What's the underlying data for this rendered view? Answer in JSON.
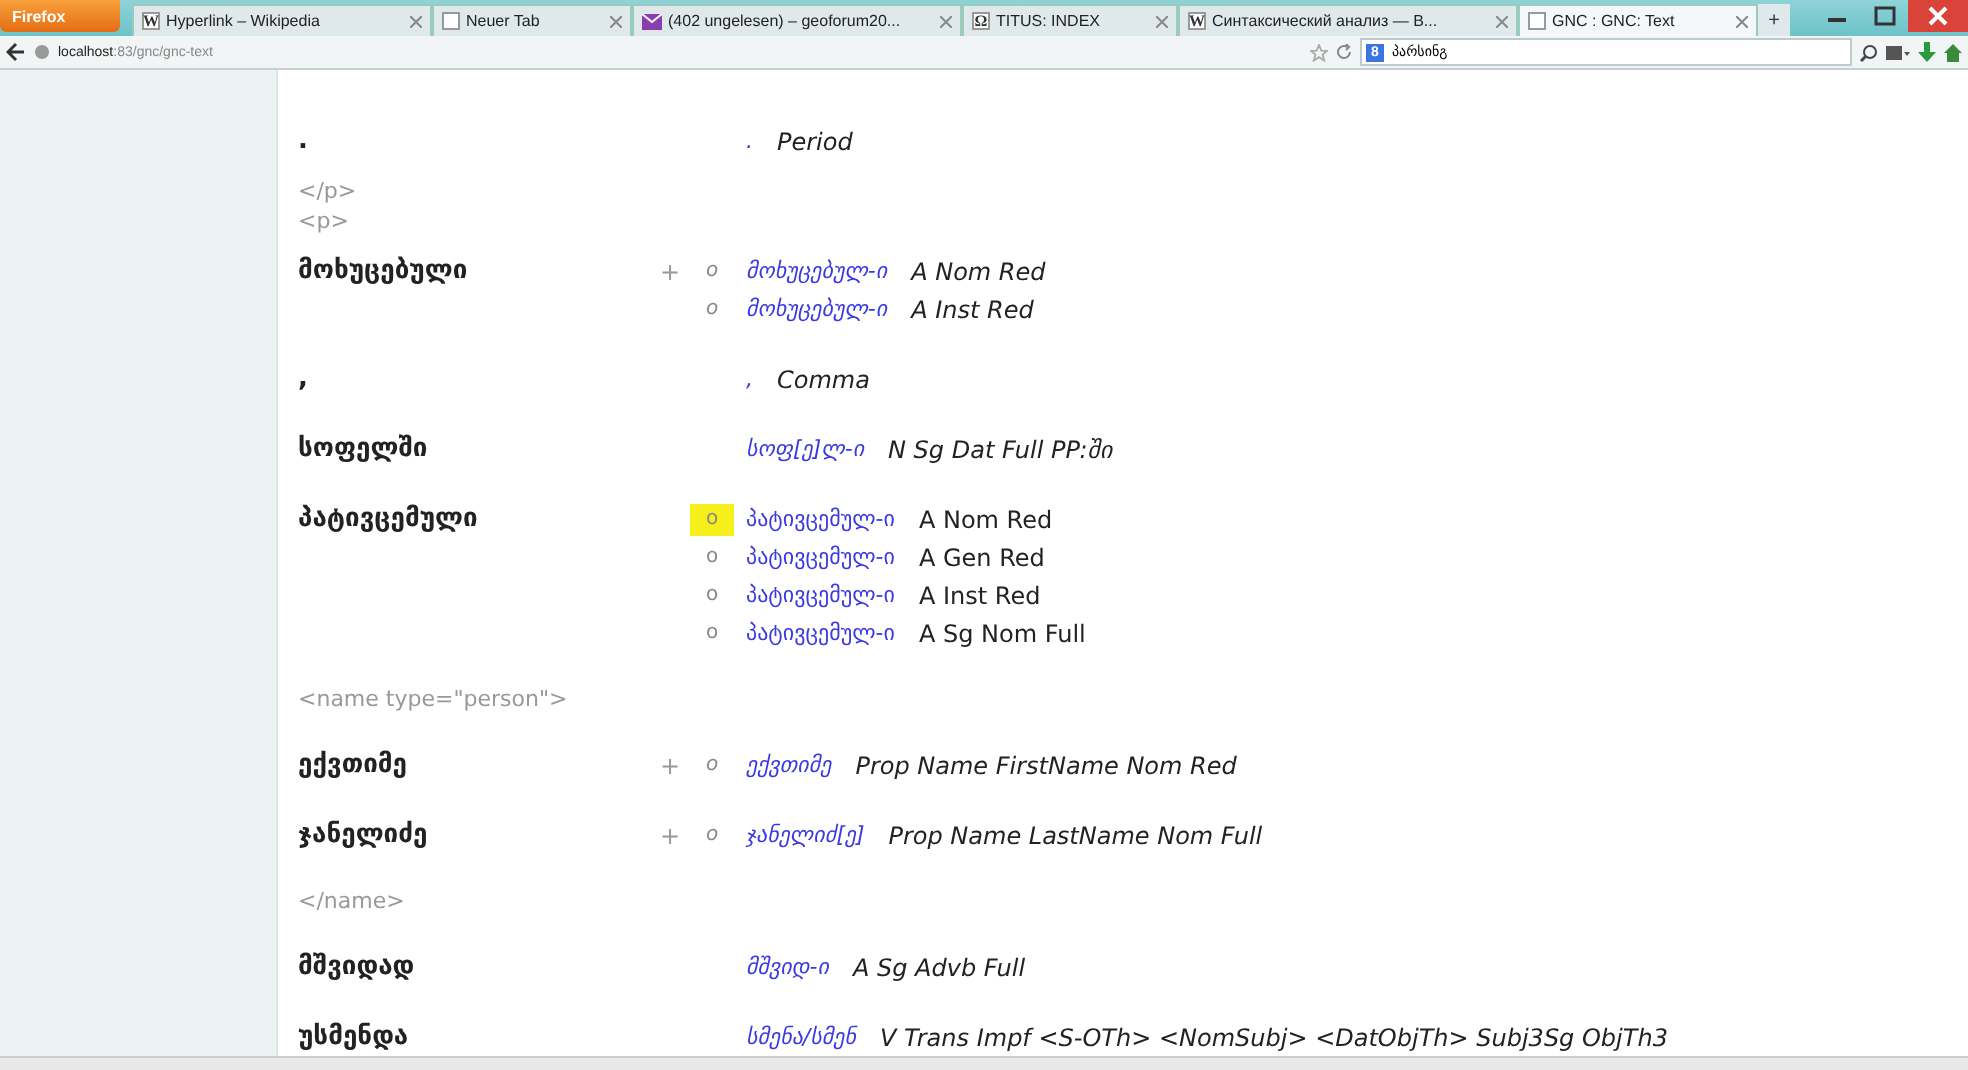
{
  "browser": {
    "menu_button": "Firefox",
    "tabs": [
      {
        "title": "Hyperlink – Wikipedia",
        "kind": "glyph",
        "icon": "W",
        "selected": false
      },
      {
        "title": "Neuer Tab",
        "kind": "page",
        "selected": false
      },
      {
        "title": "(402 ungelesen) – geoforum20...",
        "kind": "mail",
        "selected": false
      },
      {
        "title": "TITUS: INDEX",
        "kind": "glyph",
        "icon": "Ω",
        "selected": false
      },
      {
        "title": "Синтаксический анализ — В...",
        "kind": "glyph",
        "icon": "W",
        "selected": false
      },
      {
        "title": "GNC : GNC: Text",
        "kind": "page",
        "selected": true
      }
    ],
    "new_tab": "+",
    "address": {
      "host": "localhost",
      "path": ":83/gnc/gnc-text"
    },
    "search": {
      "engine": "8",
      "value": "პარსინგ"
    }
  },
  "entries": [
    {
      "kind": "word",
      "form": ".",
      "analyses": [
        {
          "lemma": ".",
          "features": "Period",
          "italic": true,
          "selected": false
        }
      ]
    },
    {
      "kind": "tag",
      "text": "</p>"
    },
    {
      "kind": "tag",
      "text": "<p>"
    },
    {
      "kind": "word",
      "form": "მოხუცებული",
      "plus": "+",
      "analyses": [
        {
          "marker": "o",
          "lemma": "მოხუცებულ-ი",
          "features": "A Nom Red",
          "italic": true,
          "selected": false
        },
        {
          "marker": "o",
          "lemma": "მოხუცებულ-ი",
          "features": "A Inst Red",
          "italic": true,
          "selected": false
        }
      ]
    },
    {
      "kind": "word",
      "form": ",",
      "analyses": [
        {
          "lemma": ",",
          "features": "Comma",
          "italic": true,
          "selected": false
        }
      ]
    },
    {
      "kind": "word",
      "form": "სოფელში",
      "analyses": [
        {
          "lemma": "სოფ[ე]ლ-ი",
          "features": "N Sg Dat Full PP:ში",
          "italic": true,
          "selected": false
        }
      ]
    },
    {
      "kind": "word",
      "form": "პატივცემული",
      "analyses": [
        {
          "marker": "o",
          "lemma": "პატივცემულ-ი",
          "features": "A Nom Red",
          "italic": false,
          "selected": true
        },
        {
          "marker": "o",
          "lemma": "პატივცემულ-ი",
          "features": "A Gen Red",
          "italic": false,
          "selected": false
        },
        {
          "marker": "o",
          "lemma": "პატივცემულ-ი",
          "features": "A Inst Red",
          "italic": false,
          "selected": false
        },
        {
          "marker": "o",
          "lemma": "პატივცემულ-ი",
          "features": "A Sg Nom Full",
          "italic": false,
          "selected": false
        }
      ]
    },
    {
      "kind": "tag",
      "text": "<name type=\"person\">"
    },
    {
      "kind": "word",
      "form": "ექვთიმე",
      "plus": "+",
      "analyses": [
        {
          "marker": "o",
          "lemma": "ექვთიმე",
          "features": "Prop Name FirstName Nom Red",
          "italic": true,
          "selected": false
        }
      ]
    },
    {
      "kind": "word",
      "form": "ჯანელიძე",
      "plus": "+",
      "analyses": [
        {
          "marker": "o",
          "lemma": "ჯანელიძ[ე]",
          "features": "Prop Name LastName Nom Full",
          "italic": true,
          "selected": false
        }
      ]
    },
    {
      "kind": "tag",
      "text": "</name>"
    },
    {
      "kind": "word",
      "form": "მშვიდად",
      "analyses": [
        {
          "lemma": "მშვიდ-ი",
          "features": "A Sg Advb Full",
          "italic": true,
          "selected": false
        }
      ]
    },
    {
      "kind": "word",
      "form": "უსმენდა",
      "analyses": [
        {
          "lemma": "სმენა/სმენ",
          "features": "V Trans Impf <S-OTh> <NomSubj> <DatObjTh> Subj3Sg ObjTh3",
          "italic": true,
          "selected": false
        }
      ]
    }
  ]
}
